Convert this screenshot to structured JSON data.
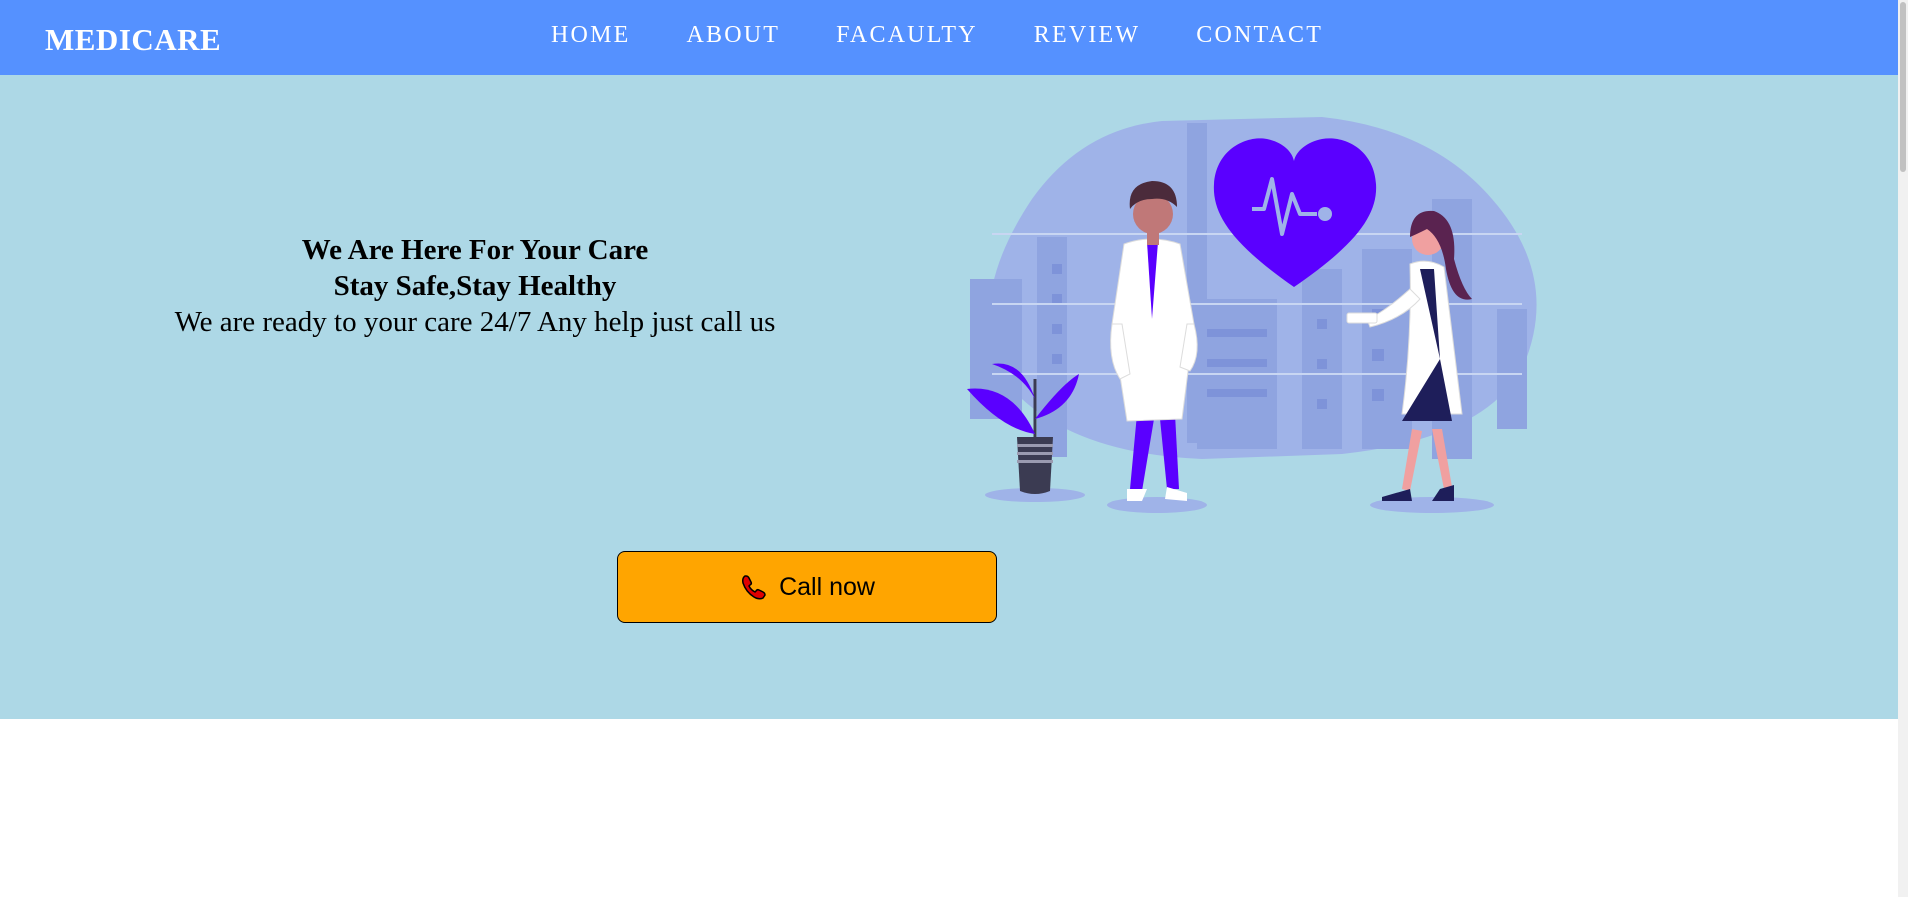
{
  "navbar": {
    "brand": "MEDICARE",
    "links": [
      "HOME",
      "ABOUT",
      "FACAULTY",
      "REVIEW",
      "CONTACT"
    ]
  },
  "hero": {
    "heading_line1": "We Are Here For Your Care",
    "heading_line2": "Stay Safe,Stay Healthy",
    "subtitle": "We are ready to your care 24/7 Any help just call us",
    "call_button": {
      "label": "Call now",
      "icon": "phone-icon"
    },
    "illustration": "doctors-heart-illustration"
  },
  "colors": {
    "navbar": "#5591ff",
    "hero_bg": "#add8e6",
    "button": "#ffa500",
    "accent_purple": "#5a00ff"
  }
}
